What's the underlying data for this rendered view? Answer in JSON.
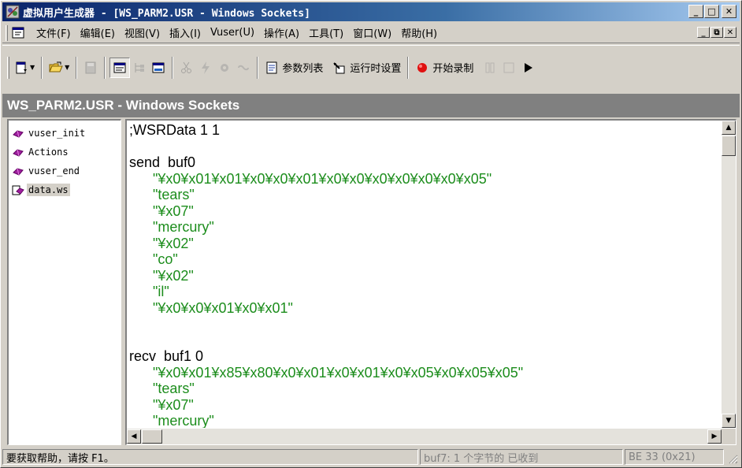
{
  "window": {
    "title": "虚拟用户生成器 - [WS_PARM2.USR - Windows Sockets]",
    "min_label": "_",
    "max_label": "□",
    "close_label": "✕"
  },
  "menubar": {
    "items": [
      {
        "label": "文件(F)"
      },
      {
        "label": "编辑(E)"
      },
      {
        "label": "视图(V)"
      },
      {
        "label": "插入(I)"
      },
      {
        "label": "Vuser(U)"
      },
      {
        "label": "操作(A)"
      },
      {
        "label": "工具(T)"
      },
      {
        "label": "窗口(W)"
      },
      {
        "label": "帮助(H)"
      }
    ],
    "mdi_min": "_",
    "mdi_restore": "⧉",
    "mdi_close": "✕"
  },
  "toolbar": {
    "params_label": "参数列表",
    "runtime_label": "运行时设置",
    "record_label": "开始录制"
  },
  "document": {
    "title": "WS_PARM2.USR - Windows Sockets"
  },
  "tree": {
    "items": [
      {
        "label": "vuser_init",
        "selected": false
      },
      {
        "label": "Actions",
        "selected": false
      },
      {
        "label": "vuser_end",
        "selected": false
      },
      {
        "label": "data.ws",
        "selected": true
      }
    ]
  },
  "editor": {
    "lines": [
      {
        "kind": "kw",
        "text": ";WSRData 1 1"
      },
      {
        "kind": "kw",
        "text": ""
      },
      {
        "kind": "kw",
        "text": "send  buf0"
      },
      {
        "kind": "str",
        "text": "      \"¥x0¥x01¥x01¥x0¥x0¥x01¥x0¥x0¥x0¥x0¥x0¥x0¥x05\""
      },
      {
        "kind": "str",
        "text": "      \"tears\""
      },
      {
        "kind": "str",
        "text": "      \"¥x07\""
      },
      {
        "kind": "str",
        "text": "      \"mercury\""
      },
      {
        "kind": "str",
        "text": "      \"¥x02\""
      },
      {
        "kind": "str",
        "text": "      \"co\""
      },
      {
        "kind": "str",
        "text": "      \"¥x02\""
      },
      {
        "kind": "str",
        "text": "      \"il\""
      },
      {
        "kind": "str",
        "text": "      \"¥x0¥x0¥x01¥x0¥x01\""
      },
      {
        "kind": "kw",
        "text": ""
      },
      {
        "kind": "kw",
        "text": ""
      },
      {
        "kind": "kw",
        "text": "recv  buf1 0"
      },
      {
        "kind": "str",
        "text": "      \"¥x0¥x01¥x85¥x80¥x0¥x01¥x0¥x01¥x0¥x05¥x0¥x05¥x05\""
      },
      {
        "kind": "str",
        "text": "      \"tears\""
      },
      {
        "kind": "str",
        "text": "      \"¥x07\""
      },
      {
        "kind": "str",
        "text": "      \"mercury\""
      }
    ]
  },
  "statusbar": {
    "help_text": "要获取帮助，请按 F1。",
    "buffer_text": "buf7: 1 个字节的 已收到",
    "offset_text": "BE 33 (0x21)"
  },
  "colors": {
    "title_gradient_start": "#0a246a",
    "string_green": "#1c8d1c",
    "record_red": "#e01010",
    "panel_gray": "#d4d0c8"
  },
  "icons": {
    "app": "vugen-app-icon",
    "doc": "document-icon",
    "tree_item": "purple-gem-icon",
    "record": "record-red-dot-icon"
  }
}
